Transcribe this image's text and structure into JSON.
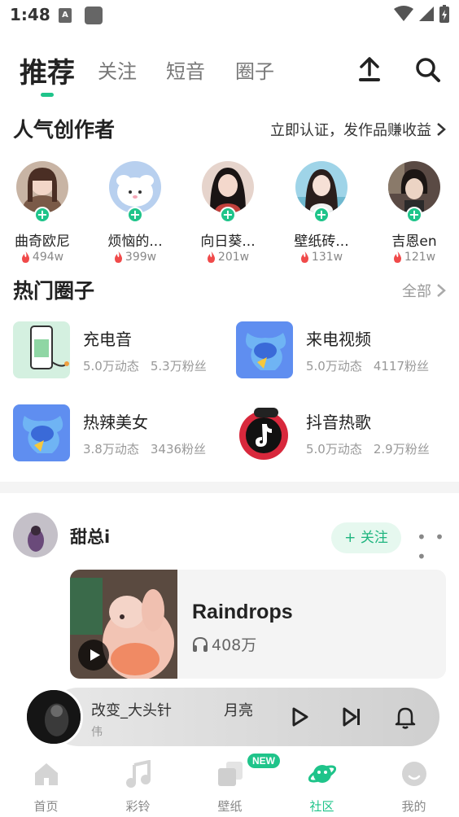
{
  "status_bar": {
    "time": "1:48",
    "icon1_letter": "A"
  },
  "top_tabs": [
    {
      "label": "推荐",
      "active": true
    },
    {
      "label": "关注",
      "active": false
    },
    {
      "label": "短音",
      "active": false
    },
    {
      "label": "圈子",
      "active": false
    }
  ],
  "creators_section": {
    "title": "人气创作者",
    "action": "立即认证，发作品赚收益",
    "creators": [
      {
        "name": "曲奇欧尼",
        "heat": "494w"
      },
      {
        "name": "烦恼的...",
        "heat": "399w"
      },
      {
        "name": "向日葵...",
        "heat": "201w"
      },
      {
        "name": "壁纸砖...",
        "heat": "131w"
      },
      {
        "name": "吉恩en",
        "heat": "121w"
      }
    ]
  },
  "circles_section": {
    "title": "热门圈子",
    "action": "全部",
    "circles": [
      {
        "name": "充电音",
        "posts": "5.0万动态",
        "fans": "5.3万粉丝"
      },
      {
        "name": "来电视频",
        "posts": "5.0万动态",
        "fans": "4117粉丝"
      },
      {
        "name": "热辣美女",
        "posts": "3.8万动态",
        "fans": "3436粉丝"
      },
      {
        "name": "抖音热歌",
        "posts": "5.0万动态",
        "fans": "2.9万粉丝"
      }
    ]
  },
  "post": {
    "username": "甜总i",
    "follow_label": "+ 关注",
    "more_label": "• • •",
    "song_title": "Raindrops",
    "play_count": "408万"
  },
  "mini_player": {
    "title_left": "改变_大头针",
    "title_right": "月亮",
    "subtitle": "伟"
  },
  "bottom_tabs": [
    {
      "label": "首页",
      "icon": "home-icon",
      "active": false
    },
    {
      "label": "彩铃",
      "icon": "music-note-icon",
      "active": false
    },
    {
      "label": "壁纸",
      "icon": "wallpaper-icon",
      "active": false
    },
    {
      "label": "社区",
      "icon": "planet-icon",
      "active": true
    },
    {
      "label": "我的",
      "icon": "profile-icon",
      "active": false
    }
  ],
  "new_badge": "NEW",
  "colors": {
    "accent": "#1fc48a",
    "heat": "#f04a4a"
  }
}
